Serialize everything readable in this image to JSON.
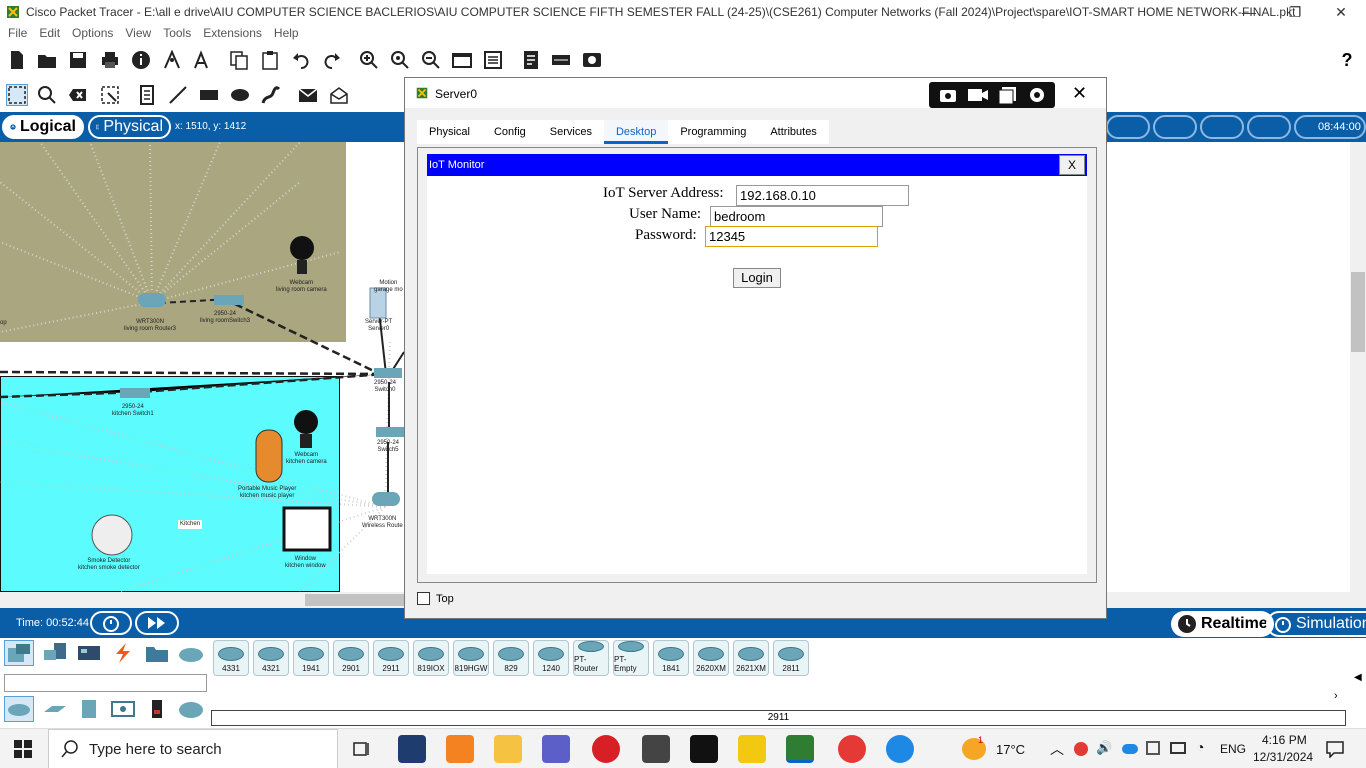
{
  "window": {
    "title": "Cisco Packet Tracer - E:\\all e drive\\AIU COMPUTER SCIENCE BACLERIOS\\AIU COMPUTER SCIENCE FIFTH SEMESTER FALL (24-25)\\(CSE261) Computer Networks (Fall 2024)\\Project\\spare\\IOT-SMART HOME NETWORK-FINAL.pkt",
    "minimize": "—",
    "restore": "❐",
    "close": "✕"
  },
  "menu": [
    "File",
    "Edit",
    "Options",
    "View",
    "Tools",
    "Extensions",
    "Help"
  ],
  "help_icon": "?",
  "viewbar": {
    "logical_label": "Logical",
    "physical_label": "Physical",
    "coords": "x: 1510, y: 1412",
    "clock": "08:44:00"
  },
  "workspace": {
    "devices": [
      {
        "label": "Webcam\nliving room camera"
      },
      {
        "label": "WRT300N\nliving room Router3"
      },
      {
        "label": "2950-24\nliving roomSwitch3"
      },
      {
        "label": "Server-PT\nServer0"
      },
      {
        "label": "Motion\ngarage mo"
      },
      {
        "label": "2950-24\nSwitch0"
      },
      {
        "label": "2950-24\nkitchen Switch1"
      },
      {
        "label": "Webcam\nkitchen camera"
      },
      {
        "label": "2950-24\nSwitch5"
      },
      {
        "label": "Portable Music Player\nkitchen music player"
      },
      {
        "label": "WRT300N\nWireless Route"
      },
      {
        "label": "Smoke Detector\nkitchen smoke detector"
      },
      {
        "label": "Window\nkitchen window"
      }
    ],
    "kitchen_tag": "Kitchen",
    "left_edge_label": "op"
  },
  "timebar": {
    "time": "Time: 00:52:44",
    "realtime_label": "Realtime",
    "simulation_label": "Simulation"
  },
  "palette": {
    "devices": [
      "4331",
      "4321",
      "1941",
      "2901",
      "2911",
      "819IOX",
      "819HGW",
      "829",
      "1240",
      "PT-Router",
      "PT-Empty",
      "1841",
      "2620XM",
      "2621XM",
      "2811"
    ],
    "selected_status": "2911"
  },
  "dialog": {
    "title": "Server0",
    "tabs": [
      "Physical",
      "Config",
      "Services",
      "Desktop",
      "Programming",
      "Attributes"
    ],
    "active_tab": "Desktop",
    "close": "✕",
    "iot": {
      "header": "IoT Monitor",
      "close": "X",
      "server_label": "IoT Server Address:",
      "server_value": "192.168.0.10",
      "user_label": "User Name:",
      "user_value": "bedroom",
      "password_label": "Password:",
      "password_value": "12345",
      "login_label": "Login"
    },
    "top_label": "Top"
  },
  "taskbar": {
    "search_placeholder": "Type here to search",
    "weather": "17°C",
    "lang": "ENG",
    "time": "4:16 PM",
    "date": "12/31/2024",
    "badge": "1"
  },
  "colors": {
    "blue_bar": "#0a5ea8",
    "living_zone": "#aaa67f",
    "kitchen_zone": "#5cfbfd",
    "iot_header": "#0000ff",
    "active_tab": "#0a64c8"
  }
}
